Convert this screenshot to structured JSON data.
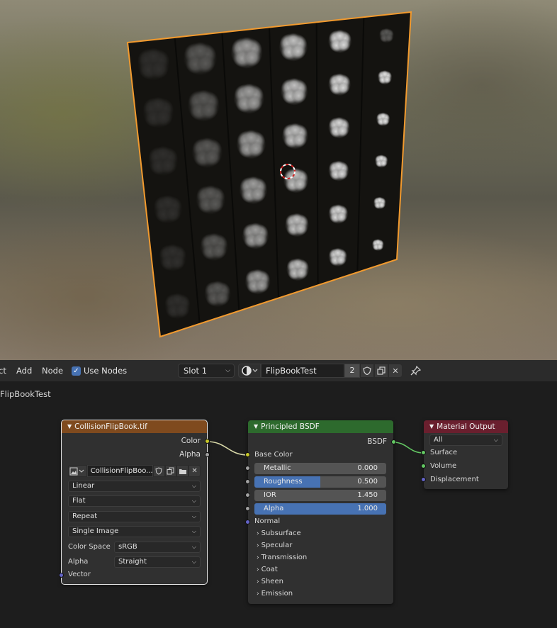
{
  "header": {
    "menus": [
      "ct",
      "Add",
      "Node"
    ],
    "use_nodes_label": "Use Nodes",
    "slot": "Slot 1",
    "material_name": "FlipBookTest",
    "material_users": "2"
  },
  "breadcrumb": "FlipBookTest",
  "nodes": {
    "image_texture": {
      "title": "CollisionFlipBook.tif",
      "outputs": [
        "Color",
        "Alpha"
      ],
      "image_name": "CollisionFlipBoo...",
      "interpolation": "Linear",
      "projection": "Flat",
      "extension": "Repeat",
      "source": "Single Image",
      "color_space_label": "Color Space",
      "color_space": "sRGB",
      "alpha_label": "Alpha",
      "alpha_mode": "Straight",
      "vector_label": "Vector"
    },
    "principled": {
      "title": "Principled BSDF",
      "output": "BSDF",
      "base_color_label": "Base Color",
      "fields": [
        {
          "label": "Metallic",
          "value": "0.000",
          "fraction": 0.0
        },
        {
          "label": "Roughness",
          "value": "0.500",
          "fraction": 0.5
        },
        {
          "label": "IOR",
          "value": "1.450",
          "fraction": 0.0
        },
        {
          "label": "Alpha",
          "value": "1.000",
          "fraction": 1.0
        }
      ],
      "normal_label": "Normal",
      "panels": [
        "Subsurface",
        "Specular",
        "Transmission",
        "Coat",
        "Sheen",
        "Emission"
      ]
    },
    "material_output": {
      "title": "Material Output",
      "target": "All",
      "inputs": [
        "Surface",
        "Volume",
        "Displacement"
      ]
    }
  },
  "colors": {
    "texture_header": "#7f4a1e",
    "shader_header": "#2d6a2d",
    "output_header": "#6a1f2e",
    "selection_outline": "#f29a2e",
    "accent": "#4772b3"
  }
}
